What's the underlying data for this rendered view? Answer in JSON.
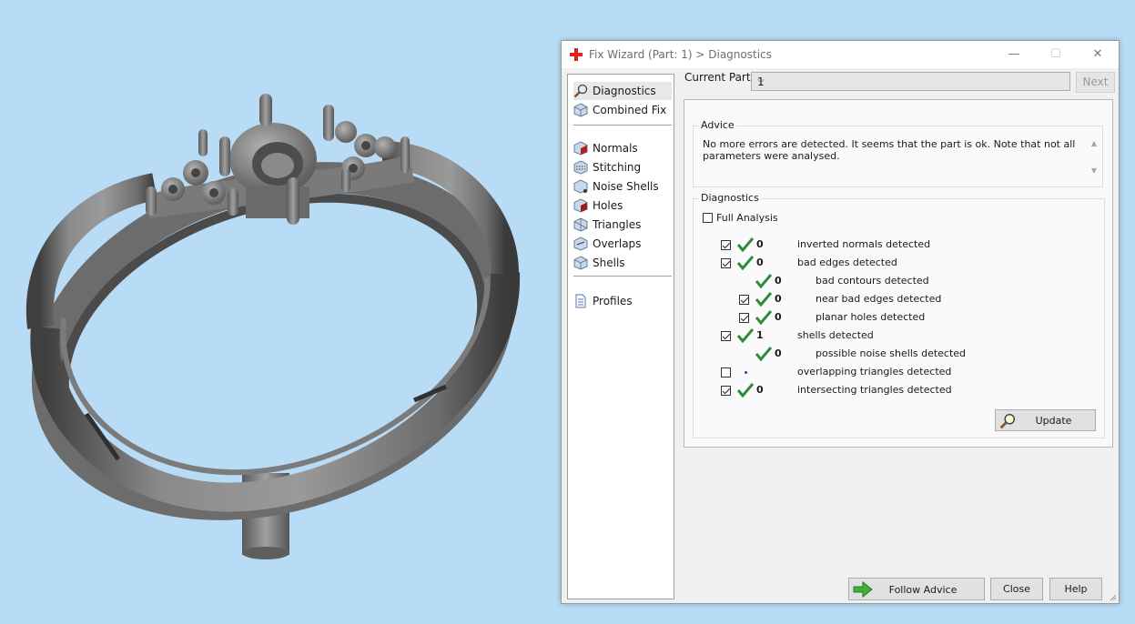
{
  "dialog": {
    "title": "Fix Wizard (Part: 1) > Diagnostics",
    "window_buttons": {
      "minimize": "—",
      "maximize": "☐",
      "close": "✕"
    }
  },
  "nav": {
    "items": [
      {
        "label": "Diagnostics",
        "icon": "magnifier-icon"
      },
      {
        "label": "Combined Fix",
        "icon": "cube-icon"
      },
      {
        "label": "Normals",
        "icon": "normals-cube-icon"
      },
      {
        "label": "Stitching",
        "icon": "stitching-cube-icon"
      },
      {
        "label": "Noise Shells",
        "icon": "noise-shells-cube-icon"
      },
      {
        "label": "Holes",
        "icon": "holes-cube-icon"
      },
      {
        "label": "Triangles",
        "icon": "triangles-cube-icon"
      },
      {
        "label": "Overlaps",
        "icon": "overlaps-cube-icon"
      },
      {
        "label": "Shells",
        "icon": "shells-cube-icon"
      },
      {
        "label": "Profiles",
        "icon": "document-icon"
      }
    ]
  },
  "current_part": {
    "label": "Current Part:",
    "value": "1",
    "next_label": "Next"
  },
  "advice": {
    "title": "Advice",
    "text": "No more errors are detected. It seems that the part is ok. Note that not all parameters were analysed."
  },
  "diagnostics": {
    "title": "Diagnostics",
    "full_analysis_label": "Full Analysis",
    "rows": [
      {
        "checkbox": true,
        "checked": true,
        "ok": true,
        "count": "0",
        "label": "inverted normals detected"
      },
      {
        "checkbox": true,
        "checked": true,
        "ok": true,
        "count": "0",
        "label": "bad edges detected"
      },
      {
        "checkbox": false,
        "checked": false,
        "ok": true,
        "count": "0",
        "label": "bad contours detected"
      },
      {
        "checkbox": true,
        "checked": true,
        "ok": true,
        "count": "0",
        "label": "near bad edges detected"
      },
      {
        "checkbox": true,
        "checked": true,
        "ok": true,
        "count": "0",
        "label": "planar holes detected"
      },
      {
        "checkbox": true,
        "checked": true,
        "ok": true,
        "count": "1",
        "label": "shells detected"
      },
      {
        "checkbox": false,
        "checked": false,
        "ok": true,
        "count": "0",
        "label": "possible noise shells detected"
      },
      {
        "checkbox": true,
        "checked": false,
        "ok": false,
        "count": "",
        "label": "overlapping triangles detected"
      },
      {
        "checkbox": true,
        "checked": true,
        "ok": true,
        "count": "0",
        "label": "intersecting triangles detected"
      }
    ],
    "update_label": "Update"
  },
  "footer": {
    "follow_advice_label": "Follow Advice",
    "close_label": "Close",
    "help_label": "Help"
  },
  "colors": {
    "background": "#b9dcf6",
    "ok_check": "#2e8b3a",
    "follow_arrow": "#3fae3a",
    "app_icon": "#e0211c"
  }
}
